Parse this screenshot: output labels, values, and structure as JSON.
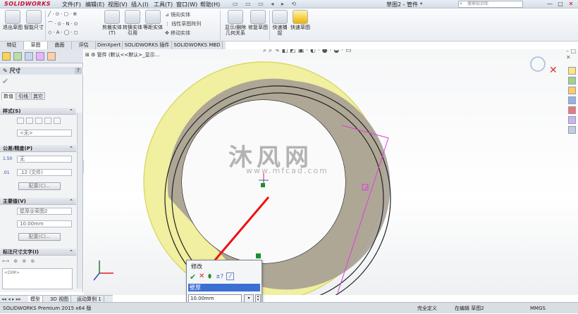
{
  "titlebar": {
    "logo": "SOLIDWORKS",
    "menus": [
      "文件(F)",
      "编辑(E)",
      "视图(V)",
      "插入(I)",
      "工具(T)",
      "窗口(W)",
      "帮助(H)"
    ],
    "doc_title": "草图2 - 管件 *",
    "search_placeholder": "搜索知识库",
    "min": "—",
    "max": "□",
    "close": "✕"
  },
  "ribbon": {
    "buttons": [
      "退出草图",
      "智能尺寸"
    ],
    "trim": "剪裁实体(T)",
    "convert": "转换实体引用",
    "offset": "等距实体",
    "mirror": "镜向实体",
    "linear_pattern": "线性草图阵列",
    "move": "移动实体",
    "show_hide": "显示/删除几何关系",
    "repair": "修复草图",
    "snap": "快速捕捉",
    "quick_sketch": "快速草图"
  },
  "tabs": [
    "特征",
    "草图",
    "曲面",
    "评估",
    "DimXpert",
    "SOLIDWORKS 插件",
    "SOLIDWORKS MBD"
  ],
  "panel": {
    "title": "尺寸",
    "help": "?",
    "confirm": "✔",
    "subtabs": [
      "数值",
      "引线",
      "其它"
    ],
    "style": {
      "header": "样式(S)",
      "value": "<无>"
    },
    "tolerance": {
      "header": "公差/精度(P)",
      "tol_value": "无",
      "precision": ".12 (文件)",
      "config": "配置(C)..."
    },
    "primary": {
      "header": "主要值(V)",
      "name": "壁厚@草图2",
      "value": "10.00mm",
      "config": "配置(C)..."
    },
    "text": {
      "header": "标注尺寸文字(I)",
      "dim": "<DIM>"
    }
  },
  "viewport": {
    "tree": "管件 (默认<<默认>_显示...",
    "watermark_cn": "沐风网",
    "watermark_en": "www.mfcad.com"
  },
  "popup": {
    "title": "修改",
    "name": "壁厚",
    "value": "10.00mm"
  },
  "bottom_tabs": [
    "模型",
    "3D 视图",
    "运动算例 1"
  ],
  "status": {
    "left": "SOLIDWORKS Premium 2015 x64 版",
    "state": "完全定义",
    "editing": "在编辑 草图2",
    "units": "MMGS"
  }
}
